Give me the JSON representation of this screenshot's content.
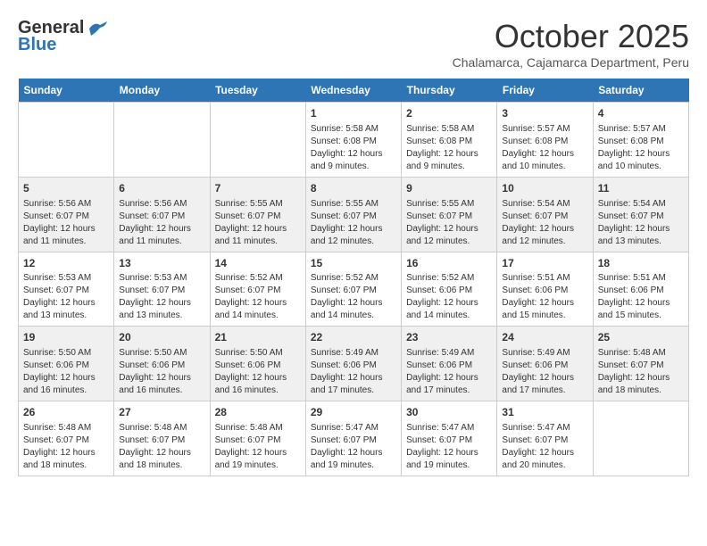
{
  "logo": {
    "line1": "General",
    "line2": "Blue"
  },
  "title": "October 2025",
  "location": "Chalamarca, Cajamarca Department, Peru",
  "weekdays": [
    "Sunday",
    "Monday",
    "Tuesday",
    "Wednesday",
    "Thursday",
    "Friday",
    "Saturday"
  ],
  "weeks": [
    [
      {
        "day": "",
        "info": ""
      },
      {
        "day": "",
        "info": ""
      },
      {
        "day": "",
        "info": ""
      },
      {
        "day": "1",
        "info": "Sunrise: 5:58 AM\nSunset: 6:08 PM\nDaylight: 12 hours and 9 minutes."
      },
      {
        "day": "2",
        "info": "Sunrise: 5:58 AM\nSunset: 6:08 PM\nDaylight: 12 hours and 9 minutes."
      },
      {
        "day": "3",
        "info": "Sunrise: 5:57 AM\nSunset: 6:08 PM\nDaylight: 12 hours and 10 minutes."
      },
      {
        "day": "4",
        "info": "Sunrise: 5:57 AM\nSunset: 6:08 PM\nDaylight: 12 hours and 10 minutes."
      }
    ],
    [
      {
        "day": "5",
        "info": "Sunrise: 5:56 AM\nSunset: 6:07 PM\nDaylight: 12 hours and 11 minutes."
      },
      {
        "day": "6",
        "info": "Sunrise: 5:56 AM\nSunset: 6:07 PM\nDaylight: 12 hours and 11 minutes."
      },
      {
        "day": "7",
        "info": "Sunrise: 5:55 AM\nSunset: 6:07 PM\nDaylight: 12 hours and 11 minutes."
      },
      {
        "day": "8",
        "info": "Sunrise: 5:55 AM\nSunset: 6:07 PM\nDaylight: 12 hours and 12 minutes."
      },
      {
        "day": "9",
        "info": "Sunrise: 5:55 AM\nSunset: 6:07 PM\nDaylight: 12 hours and 12 minutes."
      },
      {
        "day": "10",
        "info": "Sunrise: 5:54 AM\nSunset: 6:07 PM\nDaylight: 12 hours and 12 minutes."
      },
      {
        "day": "11",
        "info": "Sunrise: 5:54 AM\nSunset: 6:07 PM\nDaylight: 12 hours and 13 minutes."
      }
    ],
    [
      {
        "day": "12",
        "info": "Sunrise: 5:53 AM\nSunset: 6:07 PM\nDaylight: 12 hours and 13 minutes."
      },
      {
        "day": "13",
        "info": "Sunrise: 5:53 AM\nSunset: 6:07 PM\nDaylight: 12 hours and 13 minutes."
      },
      {
        "day": "14",
        "info": "Sunrise: 5:52 AM\nSunset: 6:07 PM\nDaylight: 12 hours and 14 minutes."
      },
      {
        "day": "15",
        "info": "Sunrise: 5:52 AM\nSunset: 6:07 PM\nDaylight: 12 hours and 14 minutes."
      },
      {
        "day": "16",
        "info": "Sunrise: 5:52 AM\nSunset: 6:06 PM\nDaylight: 12 hours and 14 minutes."
      },
      {
        "day": "17",
        "info": "Sunrise: 5:51 AM\nSunset: 6:06 PM\nDaylight: 12 hours and 15 minutes."
      },
      {
        "day": "18",
        "info": "Sunrise: 5:51 AM\nSunset: 6:06 PM\nDaylight: 12 hours and 15 minutes."
      }
    ],
    [
      {
        "day": "19",
        "info": "Sunrise: 5:50 AM\nSunset: 6:06 PM\nDaylight: 12 hours and 16 minutes."
      },
      {
        "day": "20",
        "info": "Sunrise: 5:50 AM\nSunset: 6:06 PM\nDaylight: 12 hours and 16 minutes."
      },
      {
        "day": "21",
        "info": "Sunrise: 5:50 AM\nSunset: 6:06 PM\nDaylight: 12 hours and 16 minutes."
      },
      {
        "day": "22",
        "info": "Sunrise: 5:49 AM\nSunset: 6:06 PM\nDaylight: 12 hours and 17 minutes."
      },
      {
        "day": "23",
        "info": "Sunrise: 5:49 AM\nSunset: 6:06 PM\nDaylight: 12 hours and 17 minutes."
      },
      {
        "day": "24",
        "info": "Sunrise: 5:49 AM\nSunset: 6:06 PM\nDaylight: 12 hours and 17 minutes."
      },
      {
        "day": "25",
        "info": "Sunrise: 5:48 AM\nSunset: 6:07 PM\nDaylight: 12 hours and 18 minutes."
      }
    ],
    [
      {
        "day": "26",
        "info": "Sunrise: 5:48 AM\nSunset: 6:07 PM\nDaylight: 12 hours and 18 minutes."
      },
      {
        "day": "27",
        "info": "Sunrise: 5:48 AM\nSunset: 6:07 PM\nDaylight: 12 hours and 18 minutes."
      },
      {
        "day": "28",
        "info": "Sunrise: 5:48 AM\nSunset: 6:07 PM\nDaylight: 12 hours and 19 minutes."
      },
      {
        "day": "29",
        "info": "Sunrise: 5:47 AM\nSunset: 6:07 PM\nDaylight: 12 hours and 19 minutes."
      },
      {
        "day": "30",
        "info": "Sunrise: 5:47 AM\nSunset: 6:07 PM\nDaylight: 12 hours and 19 minutes."
      },
      {
        "day": "31",
        "info": "Sunrise: 5:47 AM\nSunset: 6:07 PM\nDaylight: 12 hours and 20 minutes."
      },
      {
        "day": "",
        "info": ""
      }
    ]
  ]
}
